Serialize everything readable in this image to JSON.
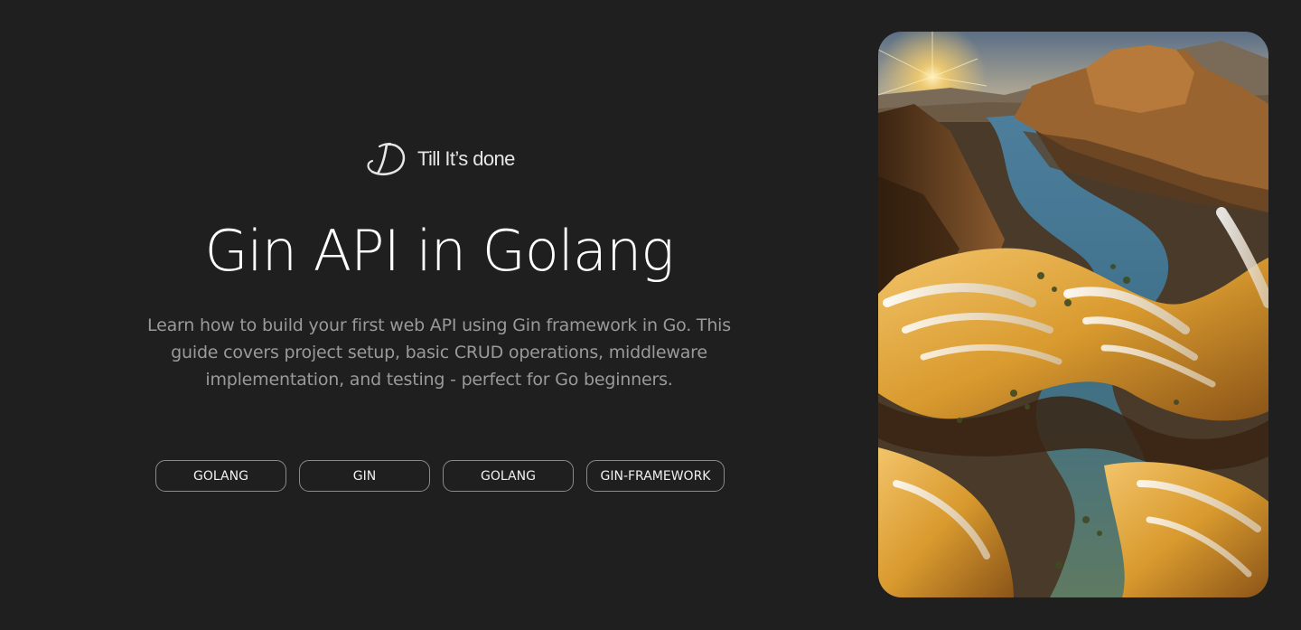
{
  "brand": {
    "name": "Till It’s done",
    "logo_icon": "d-monogram-icon"
  },
  "article": {
    "title": "Gin API in Golang",
    "description": "Learn how to build your first web API using Gin framework in Go. This guide covers project setup, basic CRUD operations, middleware implementation, and testing - perfect for Go beginners.",
    "tags": [
      "GOLANG",
      "GIN",
      "GOLANG",
      "GIN-FRAMEWORK"
    ]
  },
  "hero_image": {
    "subject": "canyon-river-landscape",
    "colors": {
      "sky": "#8ea6b8",
      "rock_dark": "#5a3a1e",
      "rock_gold": "#d99a2e",
      "ridge_white": "#efe6d6",
      "river": "#3d6f8a",
      "river_green": "#5f7a62"
    }
  },
  "colors": {
    "background": "#1f1f1f",
    "title": "#ffffff",
    "description": "#9a9a9a",
    "tag_border": "#8a8a8a"
  }
}
